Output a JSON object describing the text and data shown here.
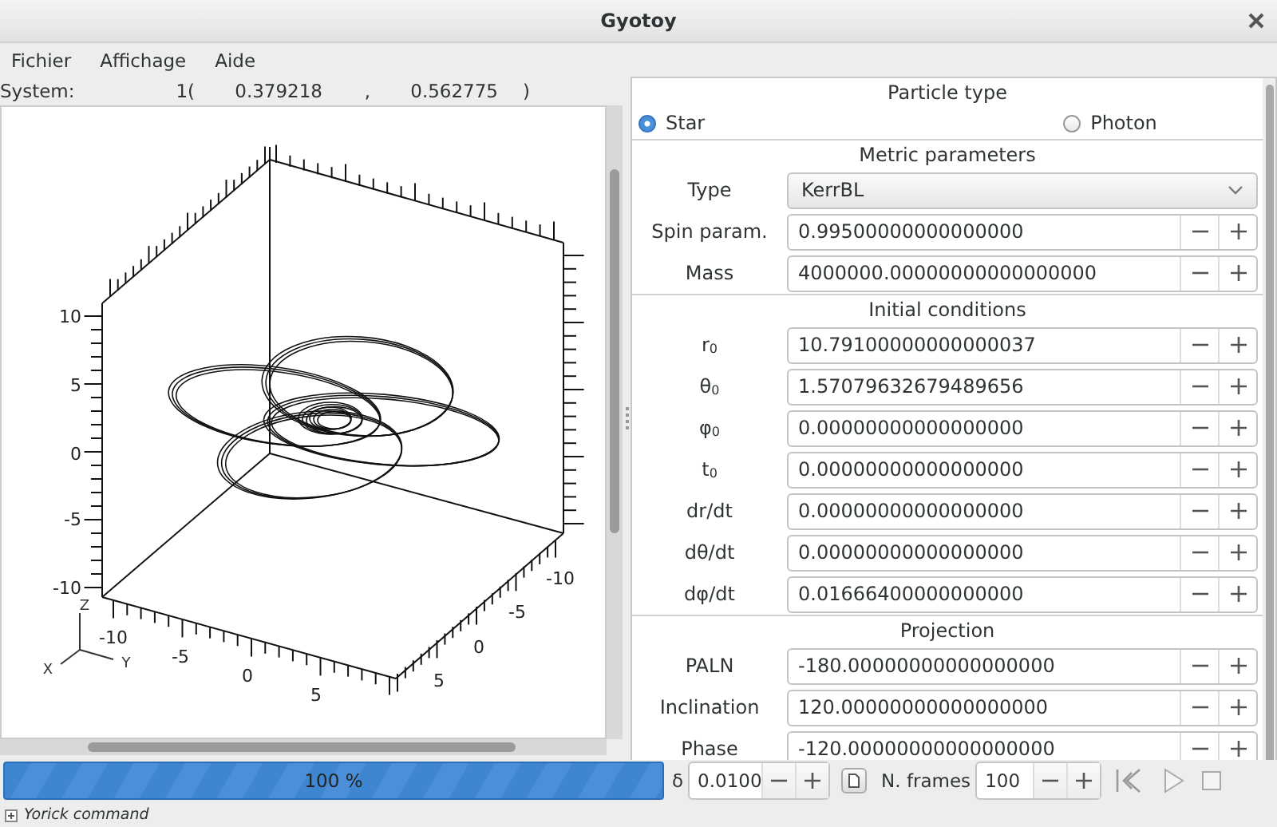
{
  "window": {
    "title": "Gyotoy"
  },
  "menu": [
    "Fichier",
    "Affichage",
    "Aide"
  ],
  "system": {
    "label": "System:",
    "values": [
      "1(",
      "0.379218",
      ",",
      "0.562775",
      ")"
    ]
  },
  "plot": {
    "z_ticks": [
      "10",
      "5",
      "0",
      "-5",
      "-10"
    ],
    "y_ticks": [
      "-10",
      "-5",
      "0",
      "5"
    ],
    "x_ticks": [
      "-10",
      "-5",
      "0",
      "5"
    ],
    "axis_labels": [
      "Z",
      "X",
      "Y"
    ]
  },
  "panel": {
    "sections": [
      {
        "title": "Particle type",
        "kind": "radios",
        "options": [
          {
            "label": "Star",
            "selected": true
          },
          {
            "label": "Photon",
            "selected": false
          }
        ]
      },
      {
        "title": "Metric parameters",
        "kind": "fields",
        "rows": [
          {
            "label": "Type",
            "kind": "dropdown",
            "value": "KerrBL"
          },
          {
            "label": "Spin param.",
            "kind": "spin",
            "value": "0.99500000000000000"
          },
          {
            "label": "Mass",
            "kind": "spin",
            "value": "4000000.00000000000000000"
          }
        ]
      },
      {
        "title": "Initial conditions",
        "kind": "fields",
        "rows": [
          {
            "label": "r$_{0}$",
            "kind": "spin",
            "value": "10.79100000000000037"
          },
          {
            "label": "θ$_{0}$",
            "kind": "spin",
            "value": "1.57079632679489656"
          },
          {
            "label": "φ$_{0}$",
            "kind": "spin",
            "value": "0.00000000000000000"
          },
          {
            "label": "t$_{0}$",
            "kind": "spin",
            "value": "0.00000000000000000"
          },
          {
            "label": "dr/dt",
            "kind": "spin",
            "value": "0.00000000000000000"
          },
          {
            "label": "dθ/dt",
            "kind": "spin",
            "value": "0.00000000000000000"
          },
          {
            "label": "dφ/dt",
            "kind": "spin",
            "value": "0.01666400000000000"
          }
        ]
      },
      {
        "title": "Projection",
        "kind": "fields",
        "rows": [
          {
            "label": "PALN",
            "kind": "spin",
            "value": "-180.00000000000000000"
          },
          {
            "label": "Inclination",
            "kind": "spin",
            "value": "120.00000000000000000"
          },
          {
            "label": "Phase",
            "kind": "spin",
            "value": "-120.00000000000000000"
          }
        ]
      }
    ]
  },
  "bottom": {
    "progress": {
      "level": 1,
      "text": "100 %"
    },
    "delta": {
      "label": "δ",
      "value": "0.0100"
    },
    "frames": {
      "label": "N. frames",
      "value": "100"
    },
    "playback": [
      {
        "kind": "rewind"
      },
      {
        "kind": "play"
      },
      {
        "kind": "stop"
      }
    ]
  },
  "command": {
    "label": "Yorick command"
  }
}
